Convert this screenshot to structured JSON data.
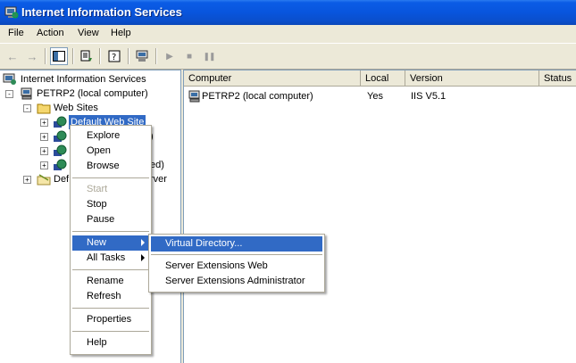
{
  "window": {
    "title": "Internet Information Services"
  },
  "menubar": {
    "items": [
      "File",
      "Action",
      "View",
      "Help"
    ]
  },
  "toolbar": {
    "buttons": [
      "back-icon",
      "forward-icon",
      "show-tree-icon",
      "export-list-icon",
      "help-icon",
      "computer-icon",
      "play-icon",
      "stop-icon",
      "pause-icon"
    ]
  },
  "tree": {
    "root": "Internet Information Services",
    "computer": "PETRP2 (local computer)",
    "web_sites": "Web Sites",
    "selected": "Default Web Site",
    "site2_suffix": ")",
    "site4_suffix": "ed)",
    "ftp_prefix": "Def",
    "ftp_suffix": "rver"
  },
  "list": {
    "columns": [
      "Computer",
      "Local",
      "Version",
      "Status"
    ],
    "rows": [
      {
        "computer": "PETRP2 (local computer)",
        "local": "Yes",
        "version": "IIS V5.1",
        "status": ""
      }
    ]
  },
  "context_menu": {
    "items": [
      "Explore",
      "Open",
      "Browse",
      "Start",
      "Stop",
      "Pause",
      "New",
      "All Tasks",
      "Rename",
      "Refresh",
      "Properties",
      "Help"
    ]
  },
  "submenu": {
    "items": [
      "Virtual Directory...",
      "Server Extensions Web",
      "Server Extensions Administrator"
    ]
  },
  "colors": {
    "titlebar": "#0855dd",
    "selection": "#316ac5",
    "chrome": "#ece9d8"
  }
}
